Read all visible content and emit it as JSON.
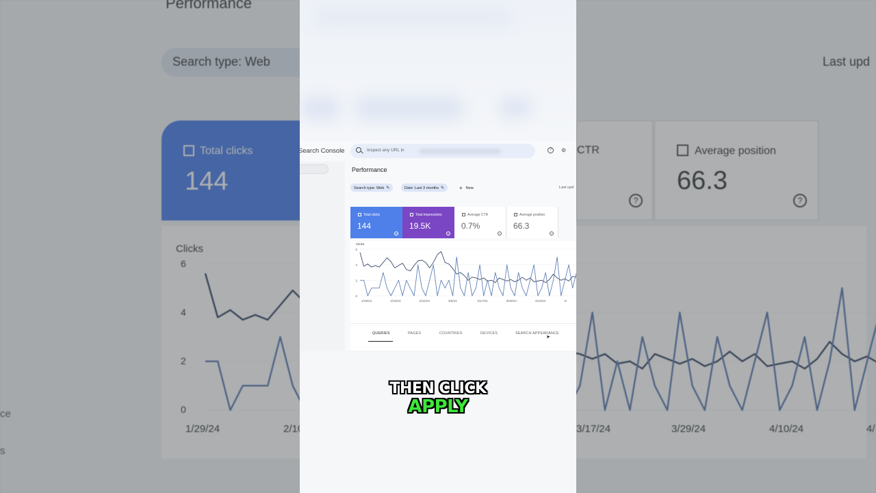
{
  "window": {
    "brand": "Search Console",
    "search_placeholder": "Inspect any URL in",
    "page_title": "Performance",
    "filters": {
      "search_type": "Search type: Web",
      "date": "Date: Last 3 months",
      "new_label": "New",
      "last_updated": "Last upd"
    }
  },
  "metrics": [
    {
      "label": "Total clicks",
      "value": "144",
      "checked": true,
      "color": "#4f80ea"
    },
    {
      "label": "Total impressions",
      "value": "19.5K",
      "checked": true,
      "color": "#7b46c4"
    },
    {
      "label": "Average CTR",
      "value": "0.7%",
      "checked": false
    },
    {
      "label": "Average position",
      "value": "66.3",
      "checked": false
    }
  ],
  "tabs": [
    "QUERIES",
    "PAGES",
    "COUNTRIES",
    "DEVICES",
    "SEARCH APPEARANCE"
  ],
  "active_tab": "QUERIES",
  "chart_data": {
    "type": "line",
    "ylabel": "Clicks",
    "ylim": [
      0,
      6
    ],
    "yticks": [
      "6",
      "4",
      "2",
      "0"
    ],
    "x_ticks": [
      "1/29/24",
      "2/10/24",
      "2/22/24",
      "3/5/24",
      "3/17/24",
      "3/29/24",
      "4/10/24",
      "4/"
    ],
    "series": [
      {
        "color": "#3b4b6b",
        "values": [
          5.6,
          3.8,
          4.1,
          3.7,
          3.9,
          3.7,
          4.3,
          4.9,
          4.4,
          3.6,
          3.9,
          4.2,
          3.4,
          3.2,
          3.9,
          4.5,
          4.6,
          4.3,
          3.6,
          4.3,
          5.3,
          5.7,
          4.3,
          4.1,
          3.5,
          2.8,
          3.0,
          2.6,
          2.0,
          2.4,
          2.3,
          2.1,
          2.3,
          1.9,
          2.0,
          1.7,
          2.3,
          2.1,
          1.9,
          2.1,
          1.8,
          2.0,
          2.4,
          2.0,
          2.3,
          1.8,
          1.9,
          2.0,
          1.7,
          2.1,
          2.8,
          2.3,
          2.0,
          2.2,
          1.9,
          2.5,
          2.4,
          2.8
        ]
      },
      {
        "color": "#5f7fb5",
        "values": [
          2,
          2,
          0,
          1,
          1,
          1,
          3,
          1,
          0,
          1,
          2,
          0,
          2,
          1,
          0,
          4,
          1,
          0,
          2,
          4,
          0,
          2,
          1,
          2,
          0,
          5,
          1,
          0,
          3,
          0,
          1,
          4,
          0,
          2,
          0,
          3,
          1,
          0,
          4,
          1,
          0,
          3,
          1,
          0,
          2,
          4,
          0,
          1,
          3,
          0,
          2,
          5,
          0,
          2,
          4,
          1,
          3,
          2
        ]
      }
    ]
  },
  "background": {
    "title": "Performance",
    "search_chip": "Search type: Web",
    "last_updated": "Last upd",
    "ctr_fragment": "CTR",
    "side_labels": [
      "ce",
      "s"
    ]
  },
  "caption": {
    "line1": "THEN CLICK",
    "line2": "APPLY"
  }
}
